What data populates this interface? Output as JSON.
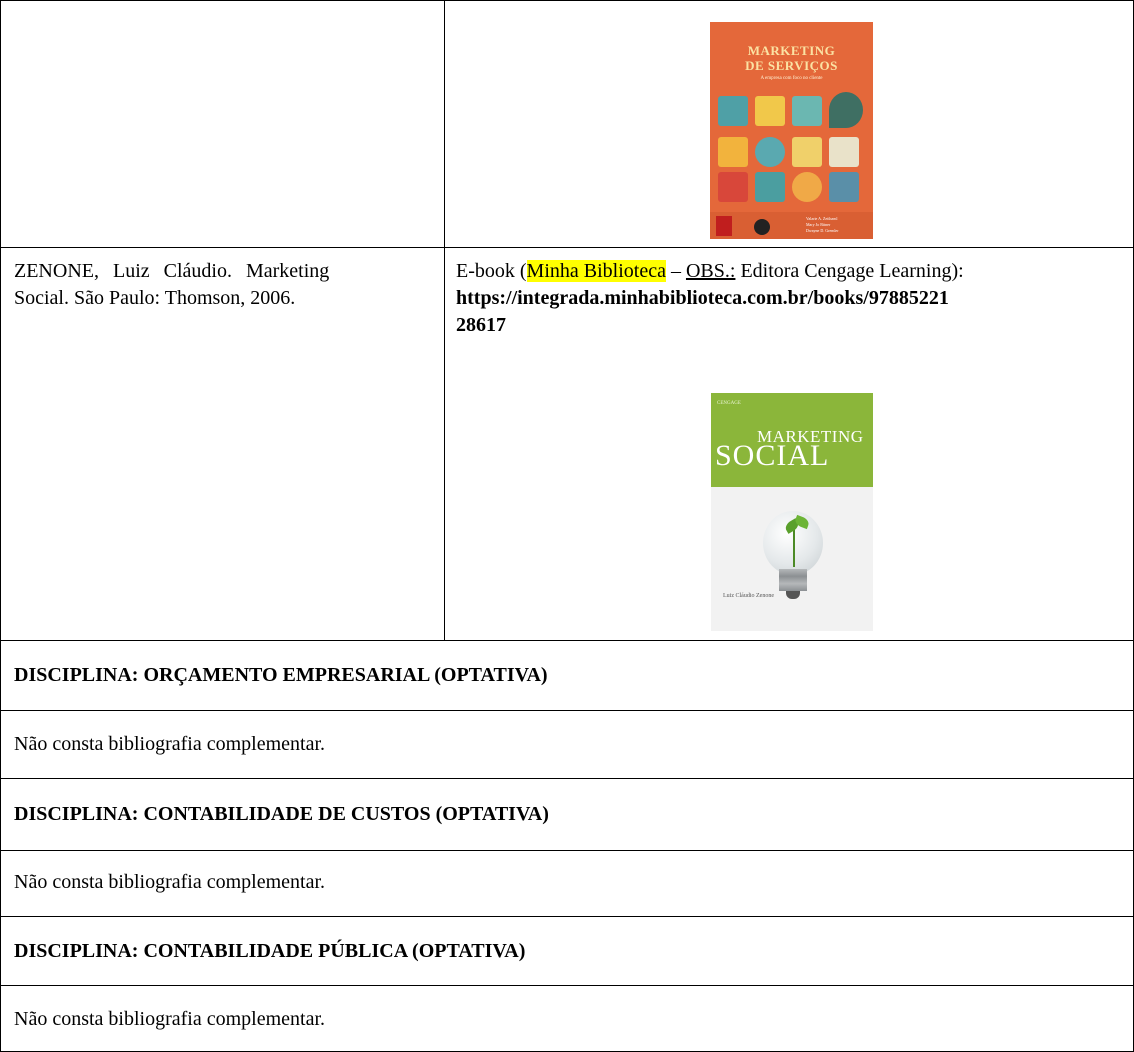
{
  "rows": {
    "marketing_servicos": {
      "cover": {
        "title_line1": "MARKETING",
        "title_line2": "DE SERVIÇOS",
        "subtitle": "A empresa com foco no cliente",
        "authors": [
          "Valarie A. Zeithaml",
          "Mary Jo Bitner",
          "Dwayne D. Gremler"
        ],
        "colors": {
          "background": "#e4683a",
          "title": "#fbe2a3"
        }
      }
    },
    "marketing_social": {
      "reference": "ZENONE, Luiz Cláudio. Marketing Social. São Paulo: Thomson, 2006.",
      "ref_line1": "ZENONE, Luiz Cláudio. Marketing",
      "ref_line2": "Social. São Paulo: Thomson, 2006.",
      "ebook_prefix": "E-book (",
      "ebook_library": "Minha Biblioteca",
      "ebook_dash": " – ",
      "ebook_obs": "OBS.:",
      "ebook_publisher": " Editora Cengage Learning):",
      "url_line1": "https://integrada.minhabiblioteca.com.br/books/97885221",
      "url_line2": "28617",
      "cover": {
        "publisher": "CENGAGE",
        "title_line1": "MARKETING",
        "title_line2": "SOCIAL",
        "author": "Luiz Cláudio Zenone",
        "colors": {
          "top": "#8bb63a"
        }
      }
    }
  },
  "sections": [
    {
      "heading": "DISCIPLINA: ORÇAMENTO EMPRESARIAL (OPTATIVA)",
      "body": "Não consta bibliografia complementar."
    },
    {
      "heading": "DISCIPLINA: CONTABILIDADE DE CUSTOS (OPTATIVA)",
      "body": "Não consta bibliografia complementar."
    },
    {
      "heading": "DISCIPLINA: CONTABILIDADE PÚBLICA (OPTATIVA)",
      "body": "Não consta bibliografia complementar."
    }
  ],
  "colors": {
    "highlight": "#ffff00",
    "border": "#000000"
  }
}
